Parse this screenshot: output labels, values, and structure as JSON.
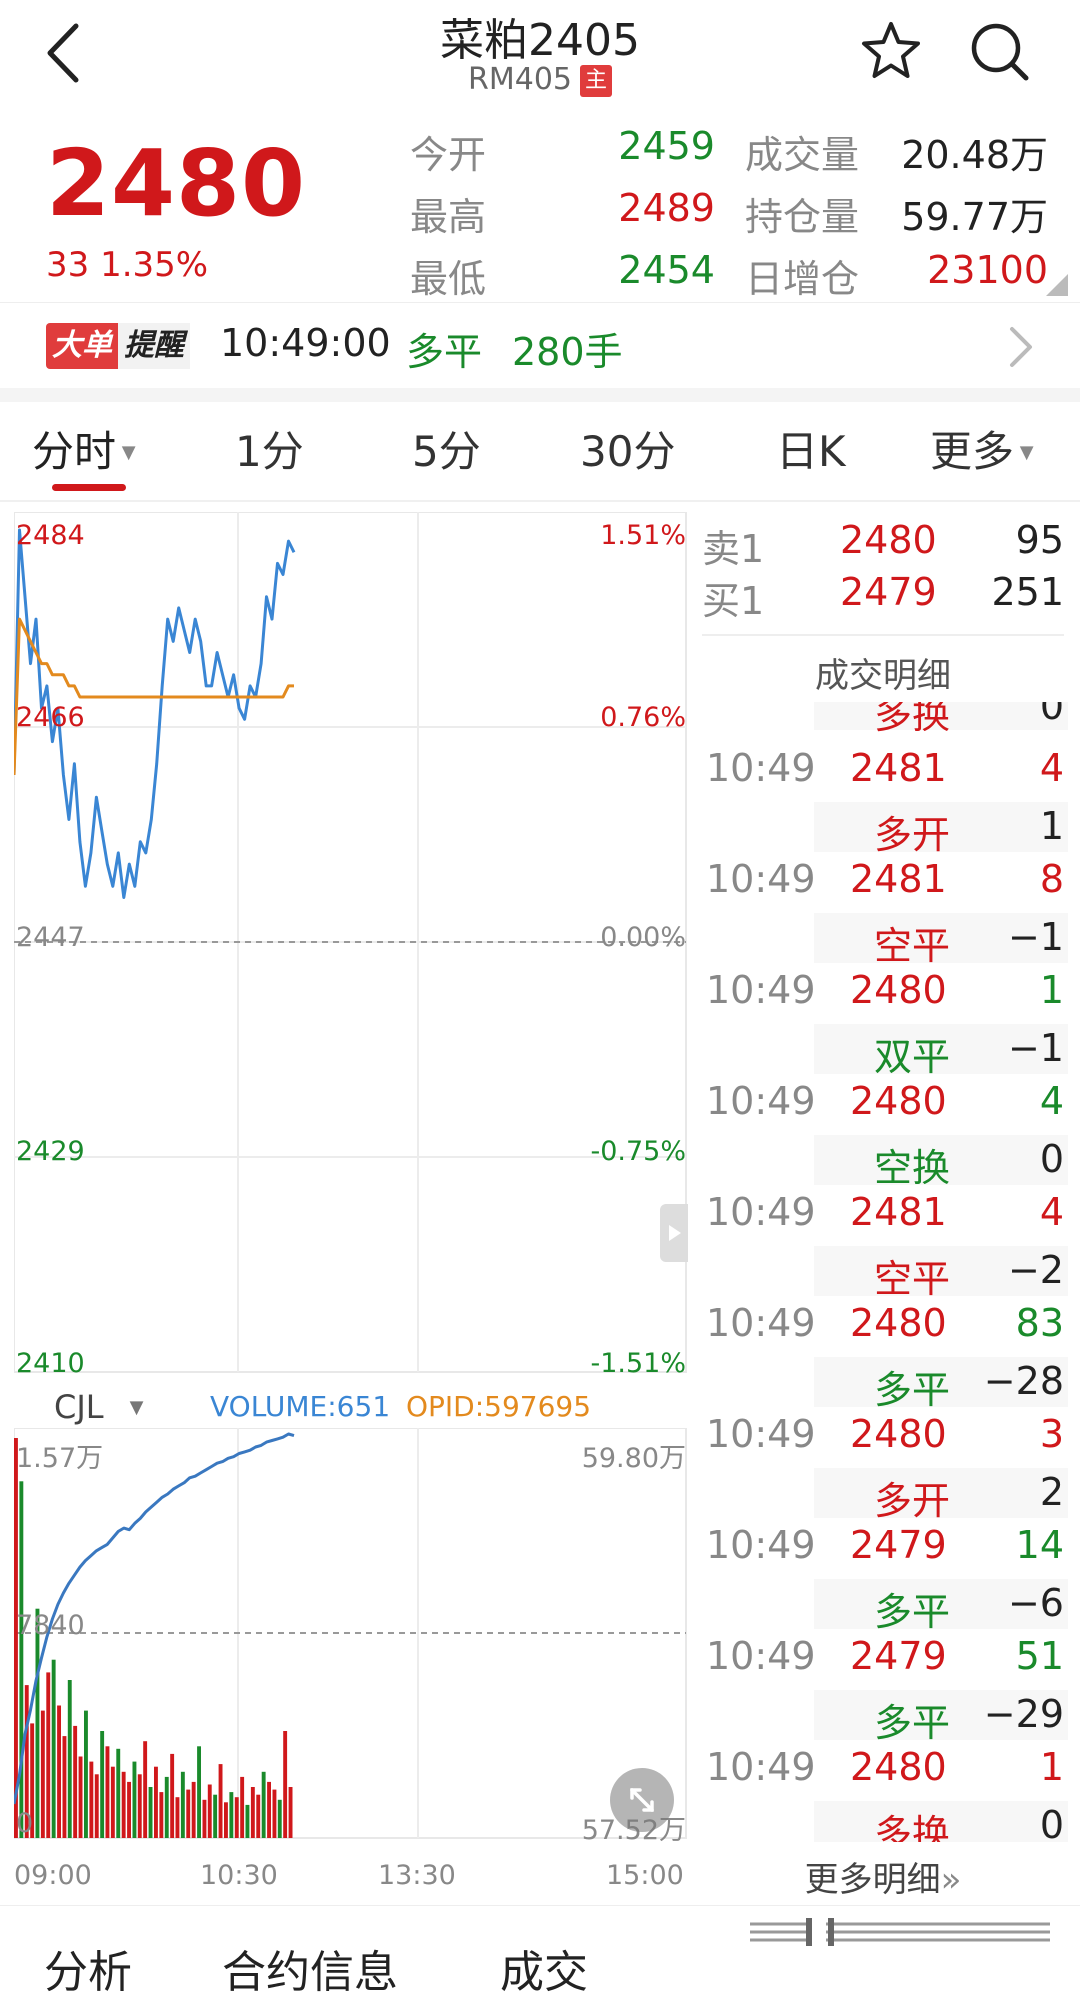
{
  "header": {
    "title": "菜粕2405",
    "subtitle": "RM405",
    "main_badge": "主"
  },
  "quote": {
    "price": "2480",
    "change": "33 1.35%",
    "open_label": "今开",
    "open": "2459",
    "high_label": "最高",
    "high": "2489",
    "low_label": "最低",
    "low": "2454",
    "volume_label": "成交量",
    "volume": "20.48万",
    "oi_label": "持仓量",
    "oi": "59.77万",
    "oi_change_label": "日增仓",
    "oi_change": "23100"
  },
  "alert": {
    "badge1": "大单",
    "badge2": "提醒",
    "time": "10:49:00",
    "type": "多平",
    "lots": "280手"
  },
  "tabs": [
    "分时",
    "1分",
    "5分",
    "30分",
    "日K",
    "更多"
  ],
  "chart_data": [
    {
      "type": "line",
      "ylim": [
        2410,
        2484
      ],
      "y_ticks_left": [
        "2484",
        "2466",
        "2447",
        "2429",
        "2410"
      ],
      "y_ticks_right": [
        "1.51%",
        "0.76%",
        "0.00%",
        "-0.75%",
        "-1.51%"
      ],
      "series": [
        {
          "values": [
            2462,
            2484,
            2478,
            2472,
            2476,
            2468,
            2470,
            2465,
            2468,
            2462,
            2458,
            2463,
            2456,
            2452,
            2455,
            2460,
            2457,
            2454,
            2452,
            2455,
            2451,
            2454,
            2452,
            2456,
            2455,
            2458,
            2463,
            2470,
            2476,
            2474,
            2477,
            2475,
            2473,
            2476,
            2474,
            2470,
            2470,
            2473,
            2471,
            2469,
            2471,
            2468,
            2467,
            2470,
            2469,
            2472,
            2478,
            2476,
            2481,
            2480,
            2483,
            2482
          ]
        },
        {
          "values": [
            2462,
            2476,
            2475,
            2474,
            2473,
            2472,
            2472,
            2471,
            2471,
            2471,
            2470,
            2470,
            2469,
            2469,
            2469,
            2469,
            2469,
            2469,
            2469,
            2469,
            2469,
            2469,
            2469,
            2469,
            2469,
            2469,
            2469,
            2469,
            2469,
            2469,
            2469,
            2469,
            2469,
            2469,
            2469,
            2469,
            2469,
            2469,
            2469,
            2469,
            2469,
            2469,
            2469,
            2469,
            2469,
            2469,
            2469,
            2469,
            2469,
            2469,
            2470,
            2470
          ]
        }
      ]
    },
    {
      "type": "bar",
      "indicator": "CJL",
      "volume_label": "VOLUME:651",
      "opid_label": "OPID:597695",
      "y_ticks_left": [
        "1.57万",
        "7840",
        "0"
      ],
      "y_ticks_right": [
        "59.80万",
        "57.52万"
      ],
      "x_ticks": [
        "09:00",
        "10:30",
        "13:30",
        "15:00"
      ],
      "ylim": [
        0,
        15700
      ],
      "values": [
        15700,
        14000,
        6000,
        4500,
        9000,
        5000,
        6500,
        7000,
        5200,
        4000,
        6200,
        4400,
        3200,
        5000,
        3000,
        2500,
        4200,
        3600,
        2800,
        3500,
        2600,
        2200,
        3000,
        2500,
        3800,
        2000,
        2800,
        1800,
        2400,
        3300,
        1600,
        2600,
        1900,
        2200,
        3600,
        1500,
        2100,
        1700,
        2900,
        1400,
        1800,
        1600,
        2400,
        1300,
        2000,
        1700,
        2600,
        2200,
        1900,
        1500,
        4200,
        2000
      ],
      "oi_values": [
        57.52,
        57.7,
        57.95,
        58.1,
        58.28,
        58.42,
        58.55,
        58.66,
        58.75,
        58.82,
        58.88,
        58.93,
        58.98,
        59.02,
        59.05,
        59.08,
        59.1,
        59.12,
        59.16,
        59.2,
        59.22,
        59.21,
        59.25,
        59.28,
        59.32,
        59.35,
        59.38,
        59.41,
        59.43,
        59.46,
        59.48,
        59.5,
        59.53,
        59.54,
        59.56,
        59.58,
        59.6,
        59.62,
        59.63,
        59.65,
        59.66,
        59.68,
        59.69,
        59.7,
        59.72,
        59.73,
        59.75,
        59.76,
        59.77,
        59.78,
        59.8,
        59.79
      ]
    }
  ],
  "order_book": {
    "ask_label": "卖1",
    "ask_price": "2480",
    "ask_vol": "95",
    "bid_label": "买1",
    "bid_price": "2479",
    "bid_vol": "251"
  },
  "trades": {
    "title": "成交明细",
    "top_partial": {
      "type": "多换",
      "oi": "0"
    },
    "rows": [
      {
        "time": "10:49",
        "price": "2481",
        "vol": "4",
        "type": "多开",
        "oi": "1",
        "vol_color": "red",
        "type_color": "red"
      },
      {
        "time": "10:49",
        "price": "2481",
        "vol": "8",
        "type": "空平",
        "oi": "−1",
        "vol_color": "red",
        "type_color": "red"
      },
      {
        "time": "10:49",
        "price": "2480",
        "vol": "1",
        "type": "双平",
        "oi": "−1",
        "vol_color": "green",
        "type_color": "green"
      },
      {
        "time": "10:49",
        "price": "2480",
        "vol": "4",
        "type": "空换",
        "oi": "0",
        "vol_color": "green",
        "type_color": "green"
      },
      {
        "time": "10:49",
        "price": "2481",
        "vol": "4",
        "type": "空平",
        "oi": "−2",
        "vol_color": "red",
        "type_color": "red"
      },
      {
        "time": "10:49",
        "price": "2480",
        "vol": "83",
        "type": "多平",
        "oi": "−28",
        "vol_color": "green",
        "type_color": "green"
      },
      {
        "time": "10:49",
        "price": "2480",
        "vol": "3",
        "type": "多开",
        "oi": "2",
        "vol_color": "red",
        "type_color": "red"
      },
      {
        "time": "10:49",
        "price": "2479",
        "vol": "14",
        "type": "多平",
        "oi": "−6",
        "vol_color": "green",
        "type_color": "green"
      },
      {
        "time": "10:49",
        "price": "2479",
        "vol": "51",
        "type": "多平",
        "oi": "−29",
        "vol_color": "green",
        "type_color": "green"
      },
      {
        "time": "10:49",
        "price": "2480",
        "vol": "1",
        "type": "多换",
        "oi": "0",
        "vol_color": "red",
        "type_color": "red"
      }
    ],
    "more": "更多明细"
  },
  "bottom_tabs": [
    "分析",
    "合约信息",
    "成交"
  ],
  "colors": {
    "up": "#d0181b",
    "down": "#1a8a2b",
    "price_line": "#3a86d4",
    "avg_line": "#e38a1e",
    "oi_line": "#3a78c0"
  }
}
